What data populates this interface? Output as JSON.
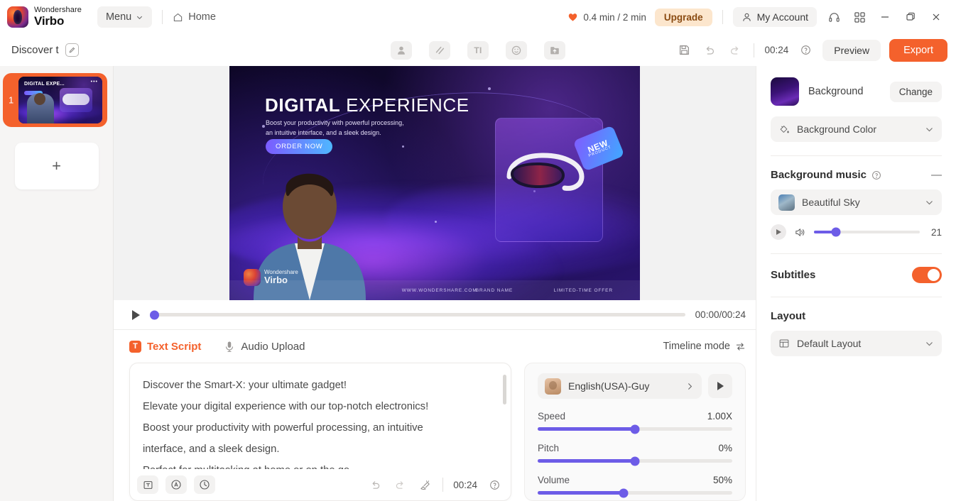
{
  "titlebar": {
    "brand_top": "Wondershare",
    "brand_bottom": "Virbo",
    "menu_label": "Menu",
    "home_label": "Home",
    "credits": "0.4 min / 2 min",
    "upgrade_label": "Upgrade",
    "account_label": "My Account",
    "icons": {
      "credit": "heart-icon",
      "support": "headset-icon",
      "apps": "grid-icon",
      "minimize": "minimize-icon",
      "maximize": "maximize-icon",
      "close": "close-icon"
    }
  },
  "subbar": {
    "project_title": "Discover t",
    "edit_icon": "pencil-icon",
    "center_tools": [
      {
        "name": "avatar-icon",
        "glyph": "avatar"
      },
      {
        "name": "effects-icon",
        "glyph": "slash"
      },
      {
        "name": "text-icon",
        "glyph": "TI"
      },
      {
        "name": "sticker-icon",
        "glyph": "smiley"
      },
      {
        "name": "upload-icon",
        "glyph": "upload"
      }
    ],
    "duration": "00:24",
    "preview_label": "Preview",
    "export_label": "Export"
  },
  "rail": {
    "slide_number": "1",
    "add_label": "+"
  },
  "canvas": {
    "headline_bold": "DIGITAL",
    "headline_light": "EXPERIENCE",
    "subtitle_line1": "Boost your productivity with powerful processing,",
    "subtitle_line2": "an intuitive interface, and a sleek design.",
    "cta_label": "ORDER NOW",
    "badge_line1": "NEW",
    "badge_line2": "PRODUCT",
    "footer_url": "WWW.WONDERSHARE.COM",
    "footer_brand": "BRAND NAME",
    "footer_offer": "LIMITED-TIME OFFER",
    "watermark_top": "Wondershare",
    "watermark_bottom": "Virbo"
  },
  "playbar": {
    "time": "00:00/00:24",
    "progress_percent": 0
  },
  "script_panel": {
    "tab_text_script": "Text Script",
    "tab_text_badge": "T",
    "tab_audio_upload": "Audio Upload",
    "timeline_mode": "Timeline mode",
    "script_lines": [
      "Discover the Smart-X: your ultimate gadget!",
      "Elevate your digital experience with our top-notch electronics!",
      "Boost your productivity with powerful processing, an intuitive",
      "interface, and a sleek design.",
      "Perfect for multitasking at home or on the go."
    ],
    "tools": {
      "insert_text": "text-box-icon",
      "pronunciation": "pronunciation-icon",
      "pause": "pause-duration-icon",
      "undo": "undo-icon",
      "redo": "redo-icon",
      "clear": "clear-brush-icon",
      "duration": "00:24",
      "help": "help-icon"
    }
  },
  "voice_panel": {
    "voice_name": "English(USA)-Guy",
    "sliders": [
      {
        "label": "Speed",
        "value": "1.00X",
        "percent": 50
      },
      {
        "label": "Pitch",
        "value": "0%",
        "percent": 50
      },
      {
        "label": "Volume",
        "value": "50%",
        "percent": 44
      }
    ]
  },
  "right_panel": {
    "background_label": "Background",
    "change_label": "Change",
    "background_color_label": "Background Color",
    "background_color_icon": "paint-bucket-icon",
    "music_section_title": "Background music",
    "music_track": "Beautiful Sky",
    "music_volume": "21",
    "music_volume_percent": 21,
    "subtitles_label": "Subtitles",
    "subtitles_on": true,
    "layout_title": "Layout",
    "layout_value": "Default Layout",
    "layout_icon": "layout-icon"
  },
  "colors": {
    "accent_orange": "#f4612c",
    "slider_purple": "#6d5ce7",
    "upgrade_bg": "#fce6cd"
  }
}
